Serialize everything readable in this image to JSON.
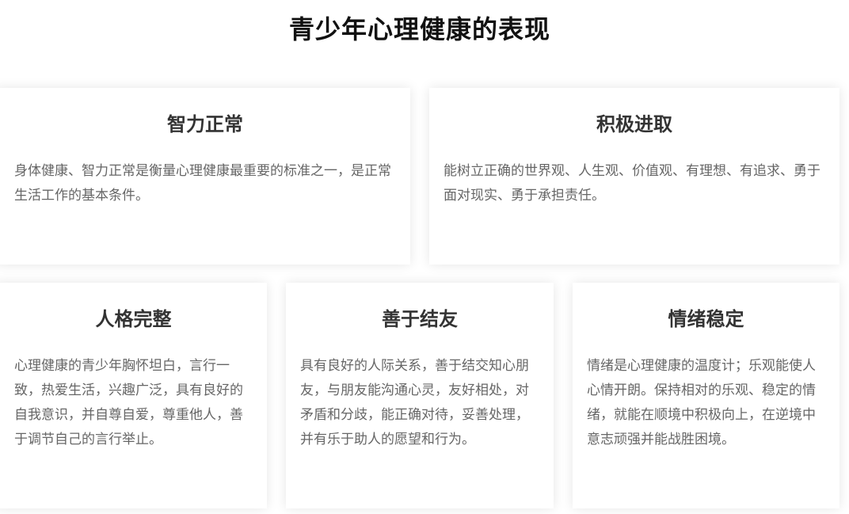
{
  "page": {
    "title": "青少年心理健康的表现"
  },
  "cards": [
    {
      "title": "智力正常",
      "text": "身体健康、智力正常是衡量心理健康最重要的标准之一，是正常生活工作的基本条件。"
    },
    {
      "title": "积极进取",
      "text": "能树立正确的世界观、人生观、价值观、有理想、有追求、勇于面对现实、勇于承担责任。"
    },
    {
      "title": "人格完整",
      "text": "心理健康的青少年胸怀坦白，言行一致，热爱生活，兴趣广泛，具有良好的自我意识，并自尊自爱，尊重他人，善于调节自己的言行举止。"
    },
    {
      "title": "善于结友",
      "text": "具有良好的人际关系，善于结交知心朋友，与朋友能沟通心灵，友好相处，对矛盾和分歧，能正确对待，妥善处理，并有乐于助人的愿望和行为。"
    },
    {
      "title": "情绪稳定",
      "text": "情绪是心理健康的温度计；乐观能使人心情开朗。保持相对的乐观、稳定的情绪，就能在顺境中积极向上，在逆境中意志顽强并能战胜困境。"
    }
  ]
}
